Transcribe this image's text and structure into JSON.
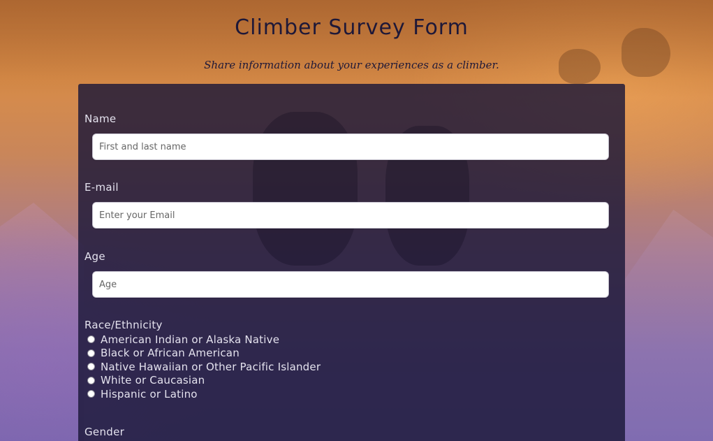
{
  "header": {
    "title": "Climber Survey Form",
    "description": "Share information about your experiences as a climber."
  },
  "form": {
    "name": {
      "label": "Name",
      "placeholder": "First and last name",
      "value": ""
    },
    "email": {
      "label": "E-mail",
      "placeholder": "Enter your Email",
      "value": ""
    },
    "age": {
      "label": "Age",
      "placeholder": "Age",
      "value": ""
    },
    "race": {
      "label": "Race/Ethnicity",
      "options": [
        "American Indian or Alaska Native",
        "Black or African American",
        "Native Hawaiian or Other Pacific Islander",
        "White or Caucasian",
        "Hispanic or Latino"
      ],
      "selected": null
    },
    "gender": {
      "label": "Gender"
    }
  },
  "colors": {
    "title_text": "#1e1838",
    "panel_background": "#1b1738",
    "label_text": "#e4e2ee",
    "input_background": "#ffffff"
  }
}
